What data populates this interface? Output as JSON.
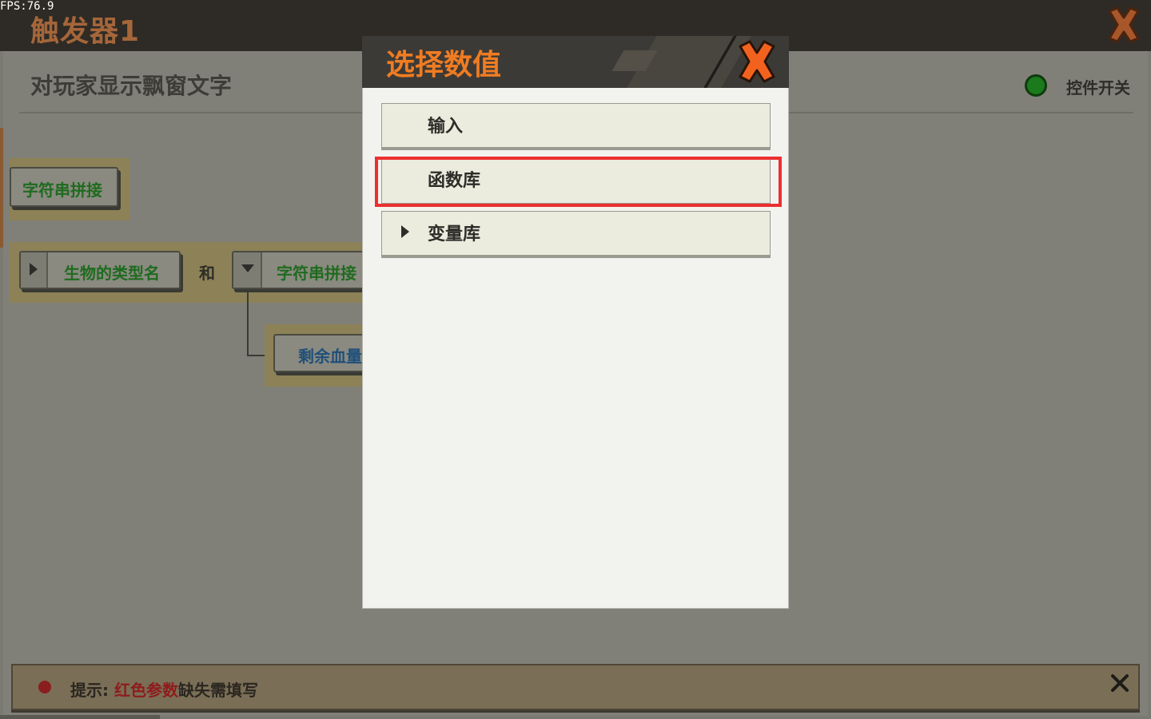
{
  "fps": "FPS:76.9",
  "window": {
    "title": "触发器1",
    "close_icon": "close-x-icon"
  },
  "action": {
    "title": "对玩家显示飘窗文字",
    "switch_label": "控件开关",
    "switch_color": "#1b7a1b"
  },
  "blocks": {
    "concat_top": "字符串拼接",
    "creature_type": "生物的类型名",
    "and_label": "和",
    "concat_inner": "字符串拼接",
    "remaining_hp": "剩余血量"
  },
  "hint": {
    "prefix": "提示:",
    "red_part": "红色参数",
    "suffix": "缺失需填写",
    "close_icon": "close-x-icon"
  },
  "dialog": {
    "title": "选择数值",
    "title_color": "#f07c22",
    "close_icon": "close-x-icon",
    "options": [
      {
        "label": "输入"
      },
      {
        "label": "函数库"
      },
      {
        "label": "变量库"
      }
    ],
    "highlight_color": "#ec2f2f"
  }
}
